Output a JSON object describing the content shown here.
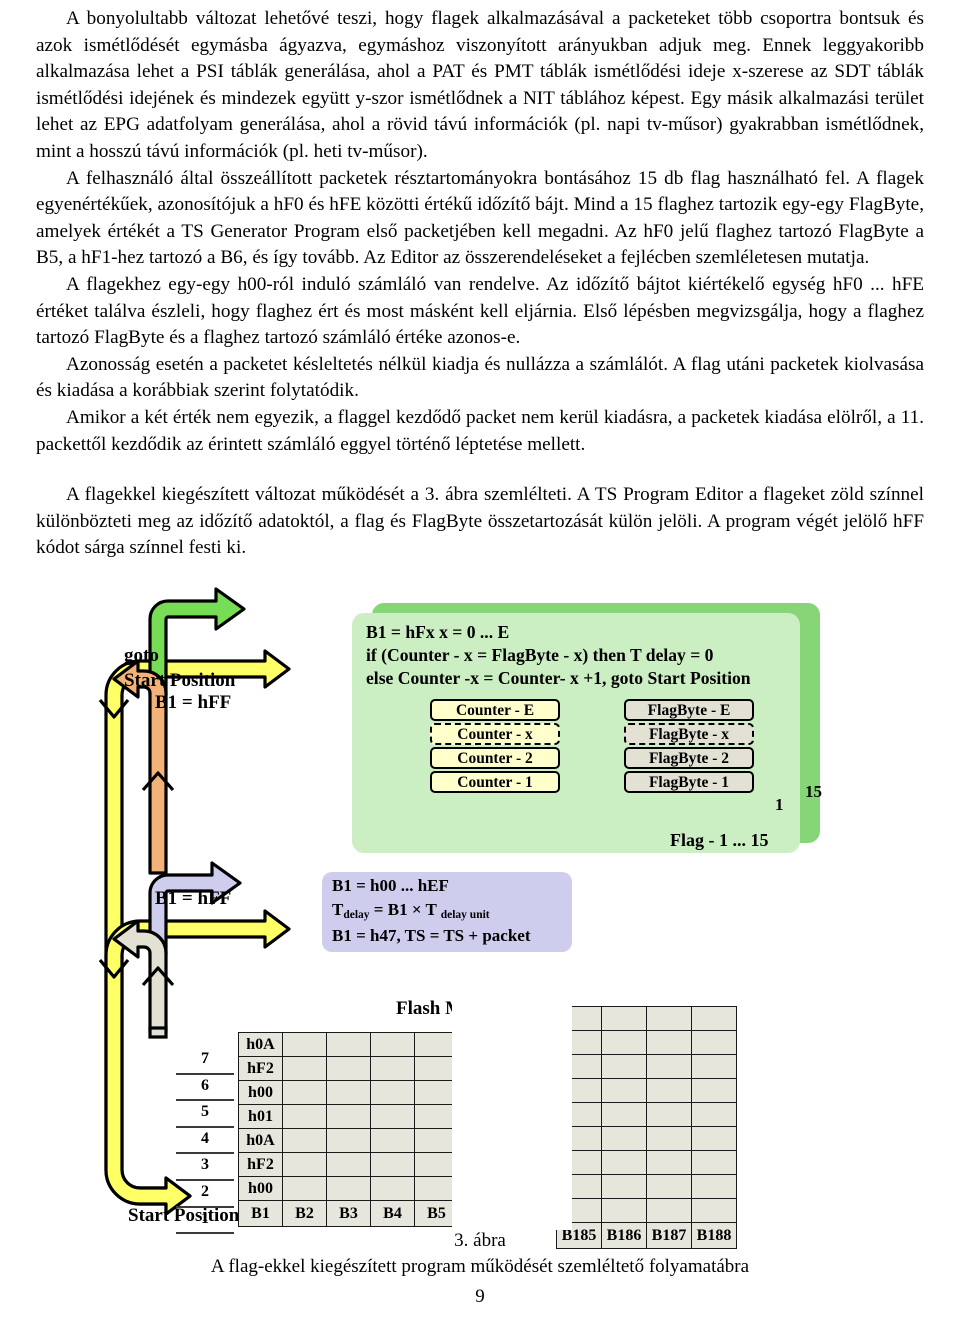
{
  "document": {
    "paragraphs": [
      "A bonyolultabb változat lehetővé teszi, hogy flagek alkalmazásával a packeteket több csoportra bontsuk és azok ismétlődését egymásba ágyazva, egymáshoz viszonyított arányukban adjuk meg. Ennek leggyakoribb alkalmazása lehet a PSI táblák generálása, ahol a PAT és PMT táblák ismétlődési ideje x-szerese az SDT táblák ismétlődési idejének és mindezek együtt y-szor ismétlődnek a NIT táblához képest. Egy másik alkalmazási terület lehet az EPG adatfolyam generálása, ahol a rövid távú információk (pl. napi tv-műsor) gyakrabban ismétlődnek, mint a hosszú távú információk (pl. heti tv-műsor).",
      "A felhasználó által összeállított packetek résztartományokra bontásához 15 db flag használható fel. A flagek egyenértékűek, azonosítójuk a hF0 és hFE közötti értékű időzítő bájt. Mind a 15 flaghez tartozik egy-egy FlagByte, amelyek értékét a TS Generator Program első packetjében kell megadni. Az hF0 jelű flaghez tartozó FlagByte a B5, a hF1-hez tartozó a B6, és így tovább. Az Editor az összerendeléseket a fejlécben szemléletesen mutatja.",
      "A flagekhez egy-egy h00-ról induló számláló van rendelve. Az időzítő bájtot kiértékelő egység hF0 ... hFE értéket találva észleli, hogy flaghez ért és most másként kell eljárnia. Első lépésben megvizsgálja, hogy a flaghez tartozó FlagByte és a flaghez tartozó számláló értéke azonos-e.",
      "Azonosság esetén a packetet késleltetés nélkül kiadja és nullázza a számlálót. A flag utáni packetek kiolvasása és kiadása a korábbiak szerint folytatódik.",
      "Amikor a két érték nem egyezik, a flaggel kezdődő packet nem kerül kiadásra, a packetek kiadása elölről, a 11. packettől kezdődik az érintett számláló eggyel történő léptetése mellett."
    ],
    "paragraph_after_gap": "A flagekkel kiegészített változat működését a 3. ábra szemlélteti. A TS Program Editor a flageket zöld színnel különbözteti meg az időzítő adatoktól, a flag és FlagByte összetartozását külön jelöli. A program végét jelölő hFF kódot sárga színnel festi ki."
  },
  "figure": {
    "goto_label_line1": "goto",
    "goto_label_line2": "Start Position",
    "b1_hff_upper": "B1 = hFF",
    "b1_hff_lower": "B1 = hFF",
    "start_position_label": "Start Position",
    "flash_memory_label": "Flash Memory",
    "flag_range_label": "Flag - 1 ... 15",
    "stack_index_front": "1",
    "stack_index_back": "15",
    "green_panel": {
      "line1": "B1 = hFx      x = 0 ... E",
      "line2": "if  (Counter - x = FlagByte - x)  then  T delay = 0",
      "line3": "else Counter -x = Counter- x +1, goto Start Position",
      "counter_boxes": [
        "Counter - E",
        "Counter - x",
        "Counter - 2",
        "Counter - 1"
      ],
      "flagbyte_boxes": [
        "FlagByte - E",
        "FlagByte - x",
        "FlagByte - 2",
        "FlagByte - 1"
      ]
    },
    "purple_panel": {
      "line1": "B1 = h00 ... hEF",
      "line2_main": "T",
      "line2_sub1": "delay",
      "line2_mid": "= B1 × T",
      "line2_sub2": "delay unit",
      "line3": "B1 = h47, TS = TS + packet"
    },
    "colors": {
      "green_arrow": "#77dd55",
      "orange_arrow": "#f3b378",
      "purple_arrow": "#cfcdee",
      "gray_arrow": "#e3e1d3",
      "yellow_arrow": "#ffff66",
      "green_panel": "#cbeec2",
      "green_panel_back": "#86d576",
      "purple_panel": "#cfcdee",
      "counter_box": "#ffffcc",
      "flagbyte_box": "#e3e1d3",
      "table_cell": "#e6e6dc"
    }
  },
  "flash_table": {
    "left_columns": [
      "B1",
      "B2",
      "B3",
      "B4",
      "B5"
    ],
    "right_columns": [
      "B185",
      "B186",
      "B187",
      "B188"
    ],
    "left_first_column_values": [
      "h0A",
      "hF2",
      "h00",
      "h01",
      "h0A",
      "hF2",
      "h00"
    ],
    "row_numbers": [
      "7",
      "6",
      "5",
      "4",
      "3",
      "2",
      "1"
    ]
  },
  "caption": {
    "figure_number": "3. ábra",
    "figure_title": "A flag-ekkel kiegészített program működését szemléltető folyamatábra"
  },
  "page_number": "9"
}
